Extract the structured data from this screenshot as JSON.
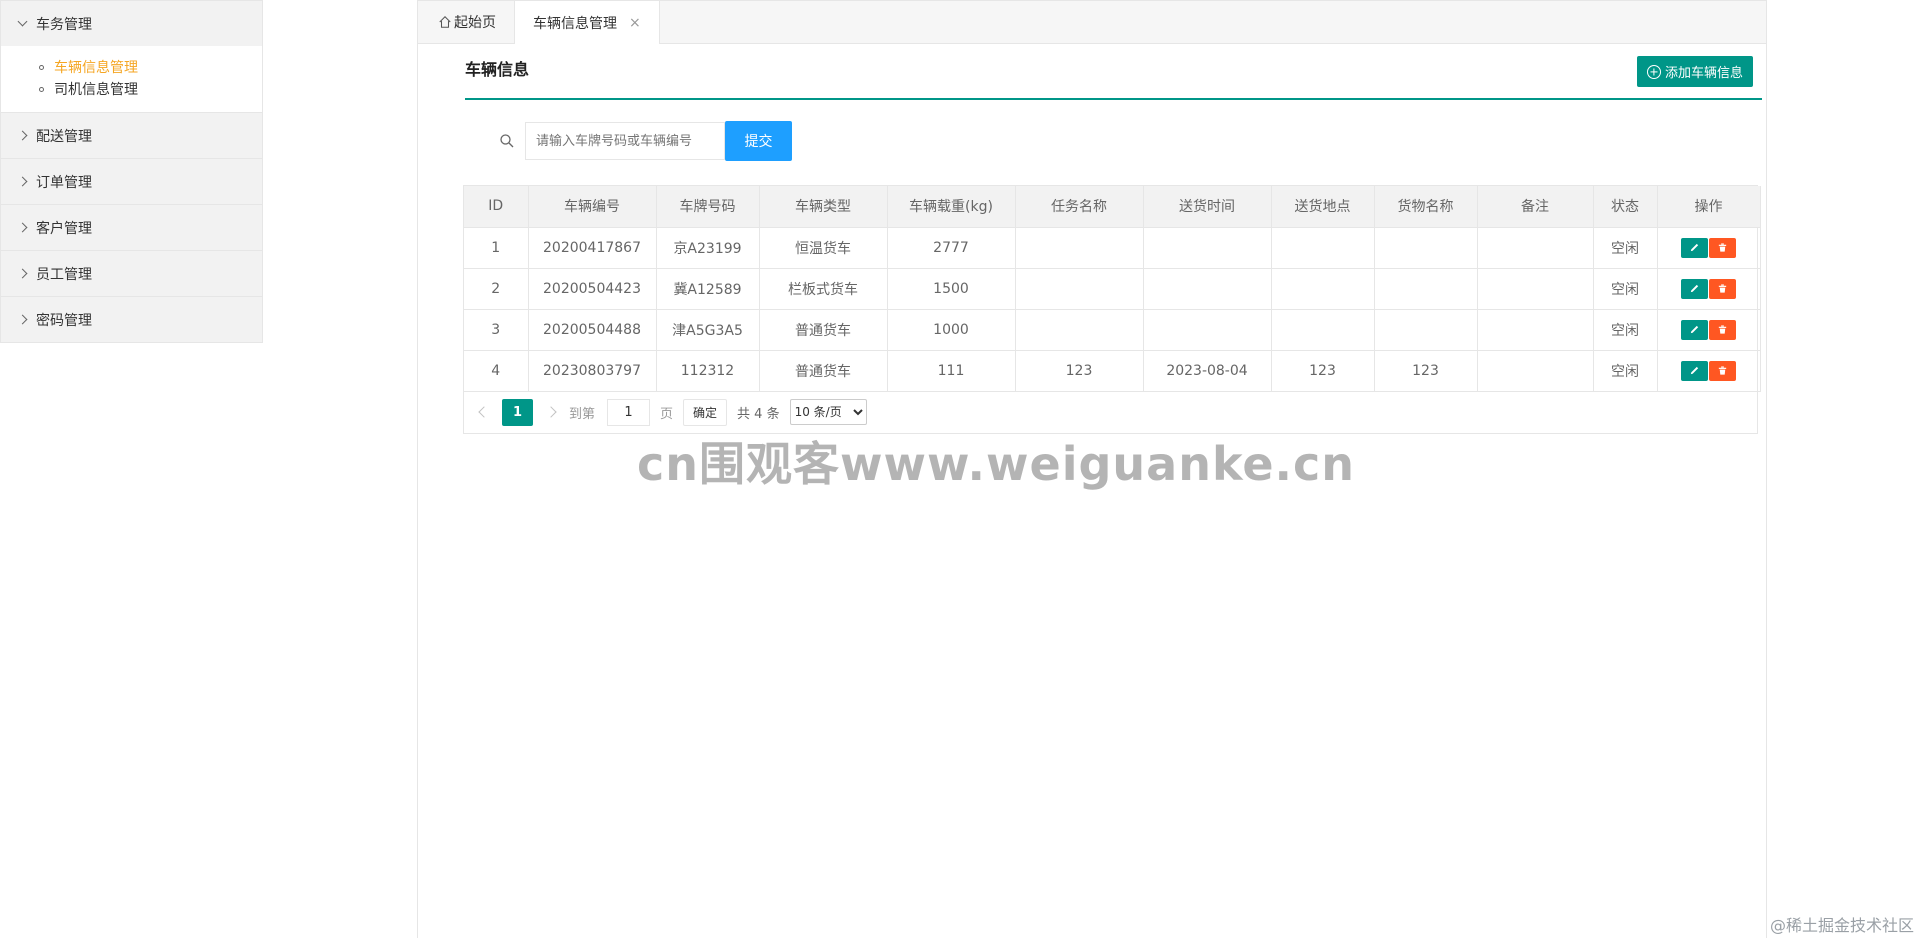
{
  "sidebar": {
    "groups": [
      {
        "label": "车务管理",
        "expanded": true,
        "items": [
          {
            "label": "车辆信息管理",
            "active": true
          },
          {
            "label": "司机信息管理",
            "active": false
          }
        ]
      },
      {
        "label": "配送管理",
        "expanded": false
      },
      {
        "label": "订单管理",
        "expanded": false
      },
      {
        "label": "客户管理",
        "expanded": false
      },
      {
        "label": "员工管理",
        "expanded": false
      },
      {
        "label": "密码管理",
        "expanded": false
      }
    ]
  },
  "tabs": {
    "home": "起始页",
    "active": "车辆信息管理",
    "close_symbol": "×"
  },
  "section": {
    "title": "车辆信息",
    "add_button": "添加车辆信息"
  },
  "search": {
    "placeholder": "请输入车牌号码或车辆编号",
    "value": "",
    "submit": "提交"
  },
  "table": {
    "columns": [
      "ID",
      "车辆编号",
      "车牌号码",
      "车辆类型",
      "车辆载重(kg)",
      "任务名称",
      "送货时间",
      "送货地点",
      "货物名称",
      "备注",
      "状态",
      "操作"
    ],
    "rows": [
      [
        "1",
        "20200417867",
        "京A23199",
        "恒温货车",
        "2777",
        "",
        "",
        "",
        "",
        "",
        "空闲"
      ],
      [
        "2",
        "20200504423",
        "冀A12589",
        "栏板式货车",
        "1500",
        "",
        "",
        "",
        "",
        "",
        "空闲"
      ],
      [
        "3",
        "20200504488",
        "津A5G3A5",
        "普通货车",
        "1000",
        "",
        "",
        "",
        "",
        "",
        "空闲"
      ],
      [
        "4",
        "20230803797",
        "112312",
        "普通货车",
        "111",
        "123",
        "2023-08-04",
        "123",
        "123",
        "",
        "空闲"
      ]
    ]
  },
  "pager": {
    "current": "1",
    "goto_label": "到第",
    "goto_value": "1",
    "page_unit": "页",
    "confirm": "确定",
    "total": "共 4 条",
    "page_size": "10 条/页"
  },
  "watermark": "cn围观客www.weiguanke.cn",
  "corner_mark": "@稀土掘金技术社区",
  "colors": {
    "primary": "#009688",
    "submit": "#1E9FFF",
    "danger": "#FF5722",
    "active_menu": "#f5a623"
  }
}
